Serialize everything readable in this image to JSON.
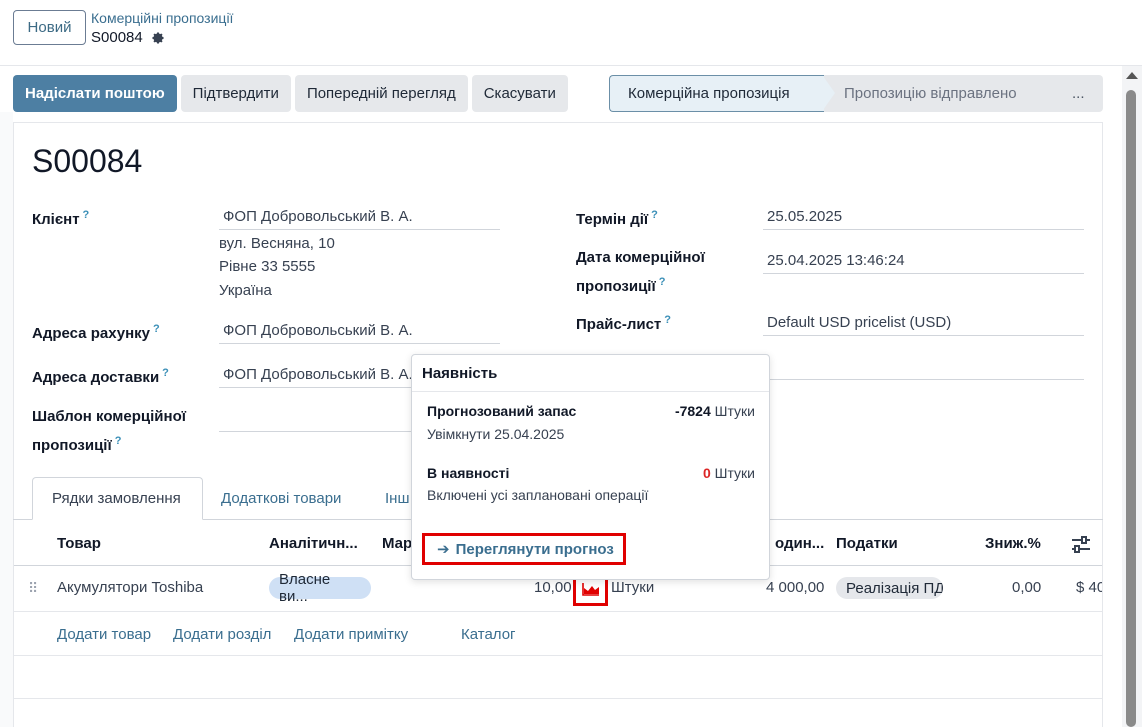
{
  "breadcrumb": {
    "new_button": "Новий",
    "parent": "Комерційні пропозиції",
    "current": "S00084"
  },
  "actions": {
    "send_email": "Надіслати поштою",
    "confirm": "Підтвердити",
    "preview": "Попередній перегляд",
    "cancel": "Скасувати"
  },
  "statusbar": {
    "stages": [
      "Комерційна пропозиція",
      "Пропозицію відправлено",
      "..."
    ]
  },
  "record": {
    "name": "S00084",
    "customer_label": "Клієнт",
    "customer": "ФОП Добровольський В. А.",
    "address_lines": [
      "вул. Весняна, 10",
      "Рівне 33 5555",
      "Україна"
    ],
    "invoice_address_label": "Адреса рахунку",
    "invoice_address": "ФОП Добровольський В. А.",
    "delivery_address_label": "Адреса доставки",
    "delivery_address": "ФОП Добровольський В. А.",
    "template_label_1": "Шаблон комерційної",
    "template_label_2": "пропозиції",
    "validity_label": "Термін дії",
    "validity": "25.05.2025",
    "quote_date_label_1": "Дата комерційної",
    "quote_date_label_2": "пропозиції",
    "quote_date": "25.04.2025 13:46:24",
    "pricelist_label": "Прайс-лист",
    "pricelist": "Default USD pricelist (USD)",
    "help_mark": "?"
  },
  "tabs": [
    "Рядки замовлення",
    "Додаткові товари",
    "Інш"
  ],
  "table": {
    "headers": {
      "product": "Товар",
      "analytic": "Аналітичн...",
      "margin": "Мар",
      "unit_price": "один...",
      "taxes": "Податки",
      "discount": "Зниж.%"
    },
    "rows": [
      {
        "product": "Акумулятори Toshiba",
        "analytic": "Власне ви...",
        "quantity": "10,00",
        "uom": "Штуки",
        "unit_price": "4 000,00",
        "tax": "Реалізація ПД",
        "discount": "0,00",
        "subtotal": "$ 40"
      }
    ],
    "add_links": [
      "Додати товар",
      "Додати розділ",
      "Додати примітку",
      "Каталог"
    ]
  },
  "popover": {
    "title": "Наявність",
    "forecast_label": "Прогнозований запас",
    "forecast_value": "-7824",
    "forecast_unit": "Штуки",
    "forecast_sub": "Увімкнути 25.04.2025",
    "onhand_label": "В наявності",
    "onhand_value": "0",
    "onhand_unit": "Штуки",
    "onhand_sub": "Включені усі заплановані операції",
    "forecast_link": "Переглянути прогноз"
  },
  "colors": {
    "primary": "#4d7fa3",
    "link": "#3a6e8f",
    "highlight": "#e00000",
    "negative": "#dc2626"
  }
}
